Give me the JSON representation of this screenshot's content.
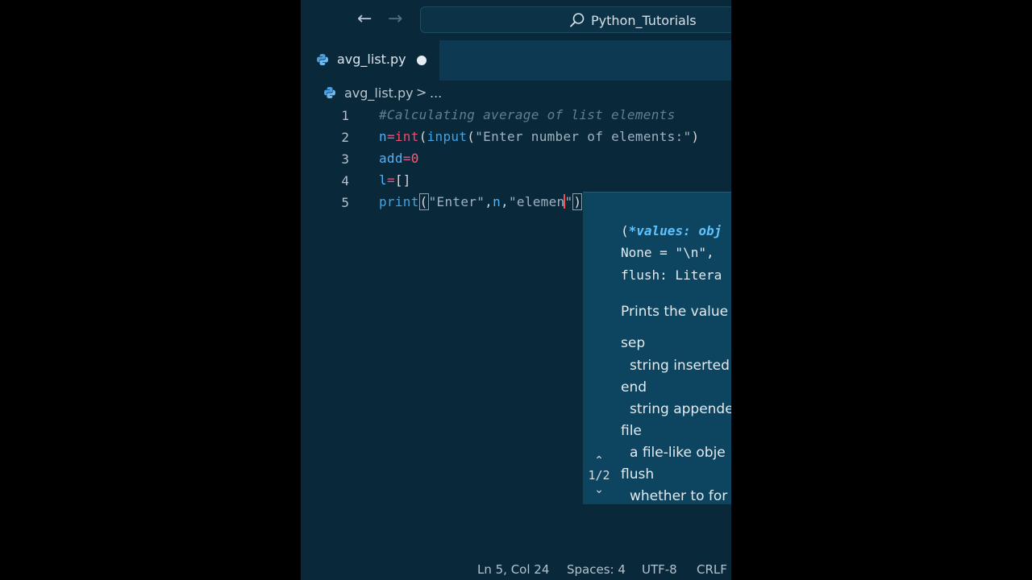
{
  "titlebar": {
    "back_label": "←",
    "forward_label": "→",
    "search_text": "Python_Tutorials"
  },
  "tab": {
    "label": "avg_list.py",
    "dirty": true
  },
  "breadcrumb": {
    "file": "avg_list.py",
    "separator": ">",
    "more": "..."
  },
  "editor": {
    "line_numbers": [
      "1",
      "2",
      "3",
      "4",
      "5"
    ],
    "line1": {
      "comment": "#Calculating average of list elements"
    },
    "line2": {
      "var": "n",
      "eq": "=",
      "fn": "int",
      "p1": "(",
      "builtin": "input",
      "p2": "(",
      "str": "\"Enter number of elements:\"",
      "p3": ")"
    },
    "line3": {
      "var": "add",
      "eq": "=",
      "num": "0"
    },
    "line4": {
      "var": "l",
      "eq": "=",
      "br": "[]"
    },
    "line5": {
      "fn": "print",
      "p1": "(",
      "s1": "\"Enter\"",
      "c1": ",",
      "var": "n",
      "c2": ",",
      "s2": "\"elemen",
      "q": "\"",
      "p2": ")"
    }
  },
  "signature_help": {
    "line1_prefix": "(",
    "line1_bold": "*values: obj",
    "line2": "None = \"\\n\",",
    "line3": "flush: Litera",
    "description": "Prints the value",
    "params": [
      {
        "name": "sep",
        "desc": "string inserted"
      },
      {
        "name": "end",
        "desc": "string appende"
      },
      {
        "name": "file",
        "desc": "a file-like obje"
      },
      {
        "name": "flush",
        "desc": "whether to for"
      }
    ],
    "count": "1/2"
  },
  "statusbar": {
    "position": "Ln 5, Col 24",
    "spaces": "Spaces: 4",
    "encoding": "UTF-8",
    "eol": "CRLF"
  },
  "colors": {
    "background": "#09283a",
    "popup": "#0d4561",
    "cursor": "#ff4a4a"
  }
}
